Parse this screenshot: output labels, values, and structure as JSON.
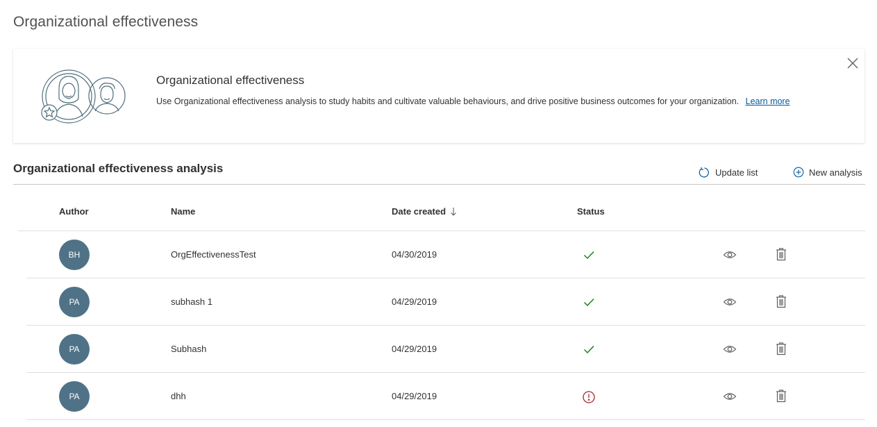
{
  "page": {
    "title": "Organizational effectiveness"
  },
  "banner": {
    "title": "Organizational effectiveness",
    "description": "Use Organizational effectiveness analysis to study habits and cultivate valuable behaviours, and drive positive business outcomes for your organization.",
    "link_label": "Learn more",
    "illustration_icon": "people-illustration",
    "close_icon": "close-icon"
  },
  "section": {
    "title": "Organizational effectiveness analysis",
    "update_label": "Update list",
    "update_icon": "refresh-icon",
    "new_label": "New analysis",
    "new_icon": "add-circle-icon"
  },
  "table": {
    "headers": {
      "author": "Author",
      "name": "Name",
      "date": "Date created",
      "status": "Status"
    },
    "sort_icon": "arrow-down-icon",
    "rows": [
      {
        "author": "BH",
        "name": "OrgEffectivenessTest",
        "date": "04/30/2019",
        "status": "success"
      },
      {
        "author": "PA",
        "name": "subhash 1",
        "date": "04/29/2019",
        "status": "success"
      },
      {
        "author": "PA",
        "name": "Subhash",
        "date": "04/29/2019",
        "status": "success"
      },
      {
        "author": "PA",
        "name": "dhh",
        "date": "04/29/2019",
        "status": "error"
      }
    ]
  },
  "colors": {
    "avatar_bg": "#4f7287",
    "success": "#107c10",
    "error": "#a4262c",
    "link": "#005a9e",
    "icon_gray": "#605e5c"
  }
}
